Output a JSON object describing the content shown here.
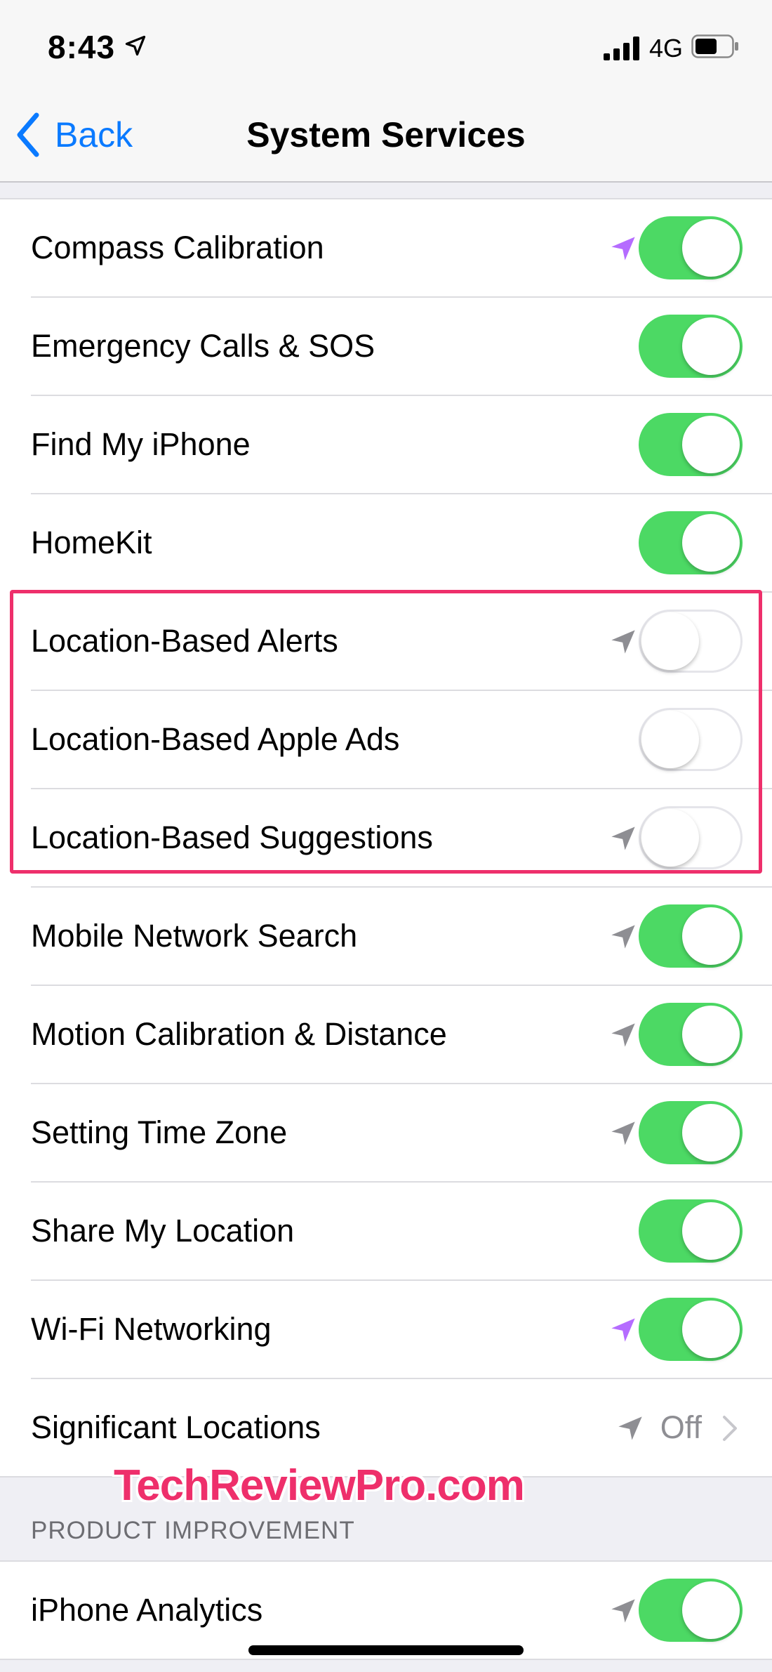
{
  "status_bar": {
    "time": "8:43",
    "network": "4G"
  },
  "nav": {
    "back_label": "Back",
    "title": "System Services"
  },
  "colors": {
    "accent": "#0a7aff",
    "toggle_on": "#4cd964",
    "highlight": "#ee2f6b",
    "arrow_recent": "#b56cff",
    "arrow_used": "#8e8e93"
  },
  "rows": [
    {
      "label": "Compass Calibration",
      "arrow": "purple",
      "on": true
    },
    {
      "label": "Emergency Calls & SOS",
      "arrow": "none",
      "on": true
    },
    {
      "label": "Find My iPhone",
      "arrow": "none",
      "on": true
    },
    {
      "label": "HomeKit",
      "arrow": "none",
      "on": true
    },
    {
      "label": "Location-Based Alerts",
      "arrow": "gray",
      "on": false
    },
    {
      "label": "Location-Based Apple Ads",
      "arrow": "none",
      "on": false
    },
    {
      "label": "Location-Based Suggestions",
      "arrow": "gray",
      "on": false
    },
    {
      "label": "Mobile Network Search",
      "arrow": "gray",
      "on": true
    },
    {
      "label": "Motion Calibration & Distance",
      "arrow": "gray",
      "on": true
    },
    {
      "label": "Setting Time Zone",
      "arrow": "gray",
      "on": true
    },
    {
      "label": "Share My Location",
      "arrow": "none",
      "on": true
    },
    {
      "label": "Wi-Fi Networking",
      "arrow": "purple",
      "on": true
    },
    {
      "label": "Significant Locations",
      "arrow": "gray",
      "value": "Off"
    }
  ],
  "watermark": "TechReviewPro.com",
  "product_section": {
    "header": "PRODUCT IMPROVEMENT",
    "rows": [
      {
        "label": "iPhone Analytics",
        "arrow": "gray",
        "on": true
      }
    ]
  }
}
